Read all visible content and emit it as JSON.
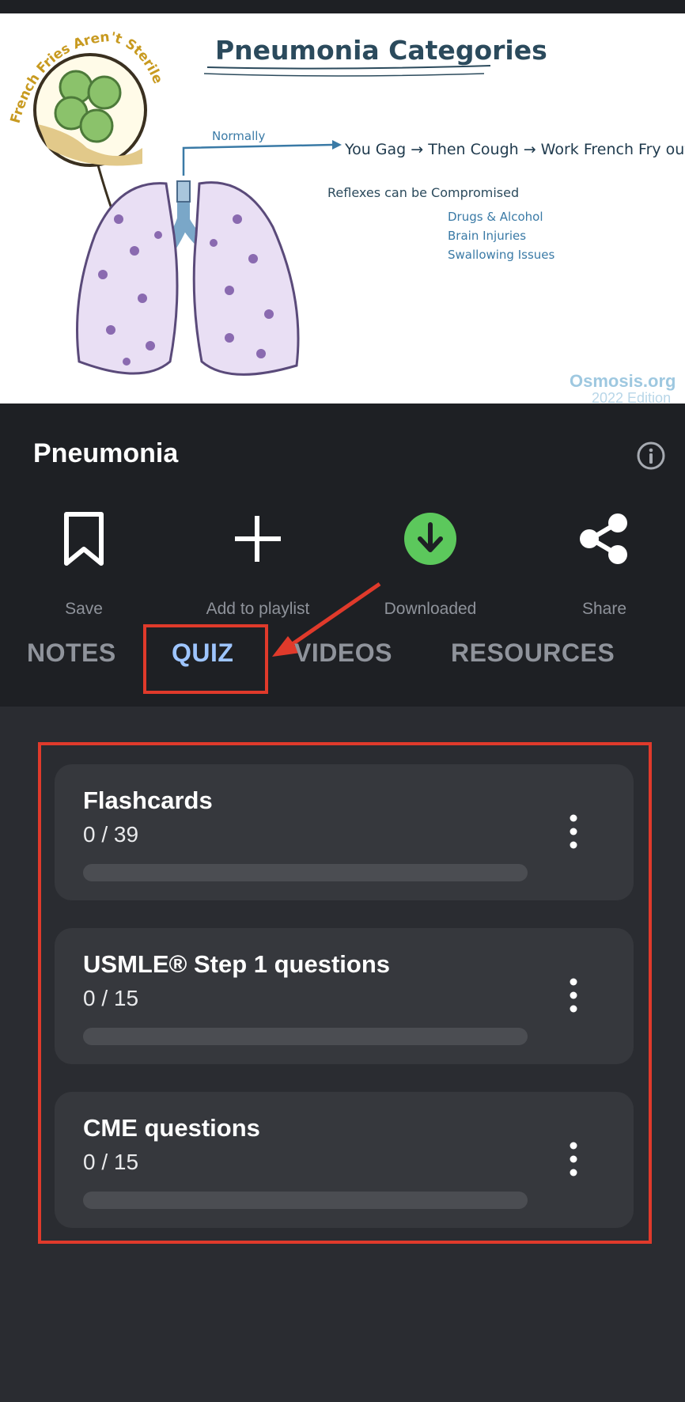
{
  "hero": {
    "heading": "Pneumonia Categories",
    "circle_caption": "French Fries Aren't Sterile",
    "normally": "Normally",
    "gag_line": "You Gag → Then Cough → Work French Fry out!",
    "reflexes": "Reflexes can be Compromised",
    "causes": [
      "Drugs & Alcohol",
      "Brain Injuries",
      "Swallowing Issues"
    ],
    "watermark_brand": "Osmosis.org",
    "watermark_edition": "2022 Edition"
  },
  "header": {
    "title": "Pneumonia",
    "info_icon": "info-icon"
  },
  "actions": [
    {
      "label": "Save",
      "icon": "bookmark-icon"
    },
    {
      "label": "Add to playlist",
      "icon": "plus-icon"
    },
    {
      "label": "Downloaded",
      "icon": "download-check-icon",
      "color": "#5cc85c"
    },
    {
      "label": "Share",
      "icon": "share-icon"
    }
  ],
  "tabs": [
    {
      "label": "NOTES",
      "active": false
    },
    {
      "label": "QUIZ",
      "active": true
    },
    {
      "label": "VIDEOS",
      "active": false
    },
    {
      "label": "RESOURCES",
      "active": false
    }
  ],
  "quiz": [
    {
      "title": "Flashcards",
      "progress_text": "0 / 39",
      "progress": 0
    },
    {
      "title": "USMLE® Step 1 questions",
      "progress_text": "0 / 15",
      "progress": 0
    },
    {
      "title": "CME questions",
      "progress_text": "0 / 15",
      "progress": 0
    }
  ],
  "colors": {
    "annotation": "#e03a2b",
    "active_tab": "#9ec5ff",
    "download_green": "#5cc85c"
  }
}
